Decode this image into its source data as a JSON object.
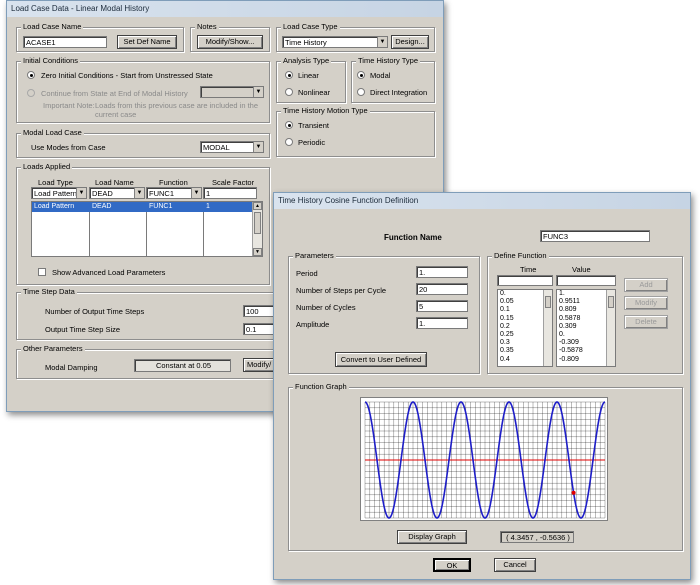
{
  "load_case_window": {
    "title": "Load Case Data - Linear Modal History",
    "load_case_name": {
      "label": "Load Case Name",
      "value": "ACASE1",
      "set_def_name_button": "Set Def Name"
    },
    "notes": {
      "label": "Notes",
      "modify_show_button": "Modify/Show..."
    },
    "load_case_type": {
      "label": "Load Case Type",
      "value": "Time History",
      "design_button": "Design..."
    },
    "initial_conditions": {
      "label": "Initial Conditions",
      "option_zero": "Zero Initial Conditions - Start from Unstressed State",
      "option_continue": "Continue from State at End of Modal History",
      "important_note_label": "Important Note:",
      "important_note_line1": "Loads from this previous case are included in the",
      "important_note_line2": "current case"
    },
    "analysis_type": {
      "label": "Analysis Type",
      "linear": "Linear",
      "nonlinear": "Nonlinear"
    },
    "time_history_type": {
      "label": "Time History Type",
      "modal": "Modal",
      "direct": "Direct Integration"
    },
    "motion_type": {
      "label": "Time History Motion Type",
      "transient": "Transient",
      "periodic": "Periodic"
    },
    "modal_load_case": {
      "label": "Modal Load Case",
      "use_modes_label": "Use Modes from Case",
      "value": "MODAL"
    },
    "loads_applied": {
      "label": "Loads Applied",
      "headers": [
        "Load Type",
        "Load Name",
        "Function",
        "Scale Factor"
      ],
      "edit_row": [
        "Load Pattern",
        "DEAD",
        "FUNC1",
        "1"
      ],
      "rows": [
        [
          "Load Pattern",
          "DEAD",
          "FUNC1",
          "1"
        ]
      ],
      "show_advanced": "Show Advanced Load Parameters"
    },
    "time_step_data": {
      "label": "Time Step Data",
      "num_steps_label": "Number of Output Time Steps",
      "num_steps_value": "100",
      "step_size_label": "Output Time Step Size",
      "step_size_value": "0.1"
    },
    "other_parameters": {
      "label": "Other Parameters",
      "modal_damping_label": "Modal Damping",
      "modal_damping_value": "Constant at 0.05",
      "modify_button": "Modify/"
    }
  },
  "function_window": {
    "title": "Time History Cosine Function Definition",
    "function_name_label": "Function Name",
    "function_name_value": "FUNC3",
    "parameters": {
      "label": "Parameters",
      "period_label": "Period",
      "period_value": "1.",
      "steps_label": "Number of Steps per Cycle",
      "steps_value": "20",
      "cycles_label": "Number of Cycles",
      "cycles_value": "5",
      "amplitude_label": "Amplitude",
      "amplitude_value": "1.",
      "convert_button": "Convert to User Defined"
    },
    "define_function": {
      "label": "Define Function",
      "time_header": "Time",
      "value_header": "Value",
      "times": [
        "0.",
        "0.05",
        "0.1",
        "0.15",
        "0.2",
        "0.25",
        "0.3",
        "0.35",
        "0.4"
      ],
      "values": [
        "1.",
        "0.9511",
        "0.809",
        "0.5878",
        "0.309",
        "0.",
        "-0.309",
        "-0.5878",
        "-0.809"
      ],
      "add_button": "Add",
      "modify_button": "Modify",
      "delete_button": "Delete"
    },
    "function_graph": {
      "label": "Function Graph",
      "display_graph_button": "Display Graph",
      "cursor_readout": "( 4.3457 , -0.5636 )"
    },
    "ok_button": "OK",
    "cancel_button": "Cancel"
  },
  "chart_data": {
    "type": "line",
    "function": "cosine",
    "period": 1,
    "cycles": 5,
    "amplitude": 1,
    "xlim": [
      0,
      5
    ],
    "ylim": [
      -1,
      1
    ],
    "grid": true,
    "line_color": "#1e1ec8",
    "grid_color": "#000000",
    "center_line_color": "#e00000",
    "cursor": {
      "x": 4.3457,
      "y": -0.5636,
      "color": "#e00000"
    }
  }
}
